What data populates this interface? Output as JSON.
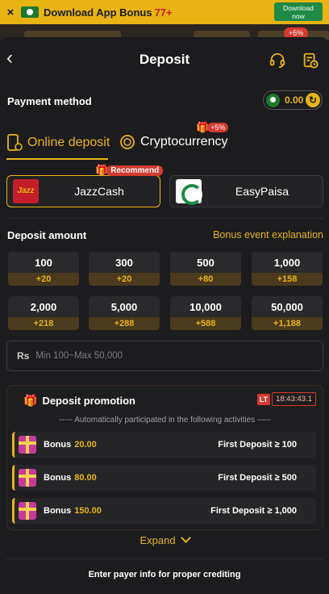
{
  "banner": {
    "close": "×",
    "text": "Download App Bonus",
    "percent": "77+",
    "button_line1": "Download",
    "button_line2": "now"
  },
  "bg_badge": "+5%",
  "header": {
    "back": "‹",
    "title": "Deposit",
    "support_icon": "headset-icon",
    "history_icon": "records-icon"
  },
  "payment_method": {
    "label": "Payment method",
    "balance": "0.00",
    "currency_flag": "pakistan-flag-icon"
  },
  "tabs": [
    {
      "label": "Online deposit",
      "icon": "phone-deposit-icon",
      "active": true
    },
    {
      "label": "Cryptocurrency",
      "icon": "coin-icon",
      "active": false,
      "badge": "+5%"
    }
  ],
  "methods": [
    {
      "name": "JazzCash",
      "logo_text": "Jazz",
      "selected": true,
      "badge": "Recommend"
    },
    {
      "name": "EasyPaisa",
      "selected": false
    }
  ],
  "deposit_amount": {
    "label": "Deposit amount",
    "link": "Bonus event explanation"
  },
  "amounts": [
    {
      "value": "100",
      "bonus": "+20"
    },
    {
      "value": "300",
      "bonus": "+20"
    },
    {
      "value": "500",
      "bonus": "+80"
    },
    {
      "value": "1,000",
      "bonus": "+158"
    },
    {
      "value": "2,000",
      "bonus": "+218"
    },
    {
      "value": "5,000",
      "bonus": "+288"
    },
    {
      "value": "10,000",
      "bonus": "+588"
    },
    {
      "value": "50,000",
      "bonus": "+1,188"
    }
  ],
  "amount_input": {
    "currency": "Rs",
    "placeholder": "Min 100~Max 50,000"
  },
  "promotion": {
    "title": "Deposit promotion",
    "timer_label": "LT",
    "timer": "18:43:43.1",
    "subtitle": "----- Automatically participated in the following activities -----",
    "items": [
      {
        "label": "Bonus",
        "value": "20.00",
        "condition": "First Deposit ≥ 100"
      },
      {
        "label": "Bonus",
        "value": "80.00",
        "condition": "First Deposit ≥ 500"
      },
      {
        "label": "Bonus",
        "value": "150.00",
        "condition": "First Deposit ≥ 1,000"
      }
    ]
  },
  "expand": "Expand",
  "footer_note": "Enter payer info for proper crediting",
  "colors": {
    "accent": "#e7b413",
    "background": "#1c1c1e",
    "badge_red": "#d43a2f",
    "bonus_strip": "#4a3a1e"
  }
}
